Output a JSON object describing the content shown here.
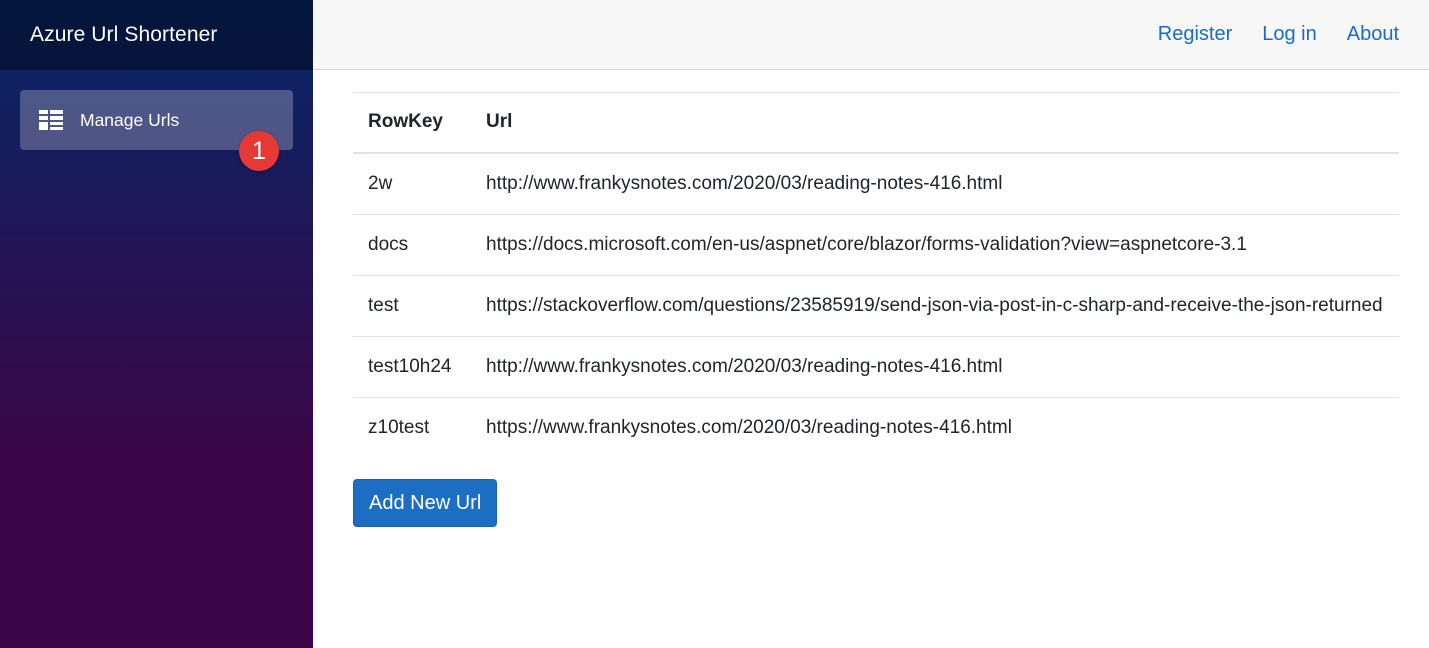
{
  "sidebar": {
    "brand": "Azure Url Shortener",
    "nav_items": [
      {
        "label": "Manage Urls",
        "icon": "list-details-icon"
      }
    ],
    "badge": "1"
  },
  "top_nav": {
    "register": "Register",
    "login": "Log in",
    "about": "About"
  },
  "table": {
    "headers": [
      "RowKey",
      "Url"
    ],
    "rows": [
      {
        "key": "2w",
        "url": "http://www.frankysnotes.com/2020/03/reading-notes-416.html"
      },
      {
        "key": "docs",
        "url": "https://docs.microsoft.com/en-us/aspnet/core/blazor/forms-validation?view=aspnetcore-3.1"
      },
      {
        "key": "test",
        "url": "https://stackoverflow.com/questions/23585919/send-json-via-post-in-c-sharp-and-receive-the-json-returned"
      },
      {
        "key": "test10h24",
        "url": "http://www.frankysnotes.com/2020/03/reading-notes-416.html"
      },
      {
        "key": "z10test",
        "url": "https://www.frankysnotes.com/2020/03/reading-notes-416.html"
      }
    ]
  },
  "add_button": "Add New Url",
  "colors": {
    "accent": "#1b6ec2",
    "link": "#1a6bc9",
    "badge": "#e53935"
  }
}
